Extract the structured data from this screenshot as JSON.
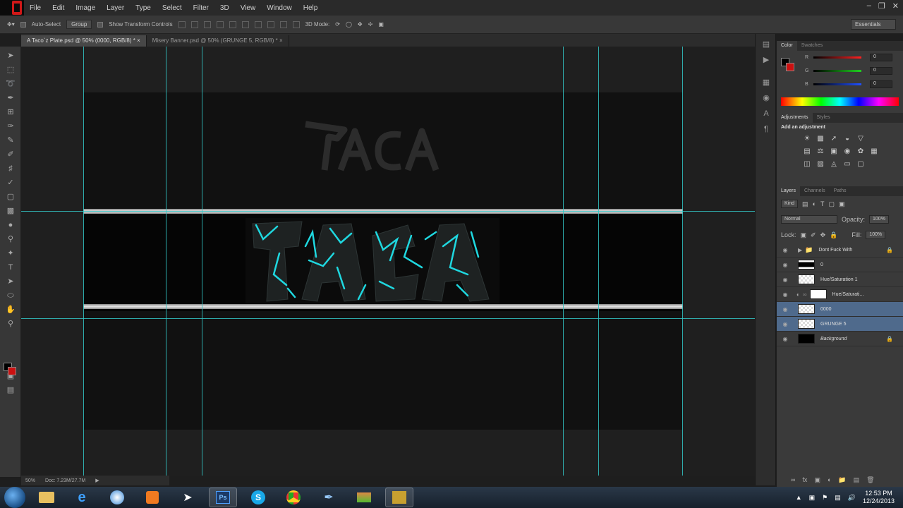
{
  "menubar": {
    "items": [
      "File",
      "Edit",
      "Image",
      "Layer",
      "Type",
      "Select",
      "Filter",
      "3D",
      "View",
      "Window",
      "Help"
    ]
  },
  "options": {
    "auto_select": "Auto-Select",
    "group": "Group",
    "show_transform": "Show Transform Controls",
    "mode_3d": "3D Mode:",
    "workspace": "Essentials"
  },
  "tabs": [
    {
      "label": "A Taco`z Plate.psd @ 50% (0000, RGB/8) *",
      "active": true
    },
    {
      "label": "Misery Banner.psd @ 50% (GRUNGE 5, RGB/8) *",
      "active": false
    }
  ],
  "status": {
    "zoom": "50%",
    "doc": "Doc: 7.23M/27.7M"
  },
  "color_panel": {
    "tabs": [
      "Color",
      "Swatches"
    ],
    "channels": [
      {
        "label": "R",
        "value": "0",
        "color": "#ff2020"
      },
      {
        "label": "G",
        "value": "0",
        "color": "#20d020"
      },
      {
        "label": "B",
        "value": "0",
        "color": "#2050ff"
      }
    ]
  },
  "adjustments": {
    "tabs": [
      "Adjustments",
      "Styles"
    ],
    "heading": "Add an adjustment"
  },
  "layers_panel": {
    "tabs": [
      "Layers",
      "Channels",
      "Paths"
    ],
    "kind": "Kind",
    "blend_mode": "Normal",
    "opacity_label": "Opacity:",
    "opacity": "100%",
    "lock_label": "Lock:",
    "fill_label": "Fill:",
    "fill": "100%",
    "layers": [
      {
        "name": "Dont Fuck With",
        "thumb": "folder",
        "lock": true,
        "selected": false
      },
      {
        "name": "0",
        "thumb": "banner",
        "lock": false,
        "selected": false
      },
      {
        "name": "Hue/Saturation 1",
        "thumb": "checker",
        "lock": false,
        "selected": false
      },
      {
        "name": "Hue/Saturati...",
        "thumb": "white",
        "lock": false,
        "selected": false
      },
      {
        "name": "0000",
        "thumb": "checker",
        "lock": false,
        "selected": true
      },
      {
        "name": "GRUNGE 5",
        "thumb": "checker",
        "lock": false,
        "selected": true
      },
      {
        "name": "Background",
        "thumb": "black",
        "lock": true,
        "selected": false
      }
    ]
  },
  "clock": {
    "time": "12:53 PM",
    "date": "12/24/2013"
  }
}
